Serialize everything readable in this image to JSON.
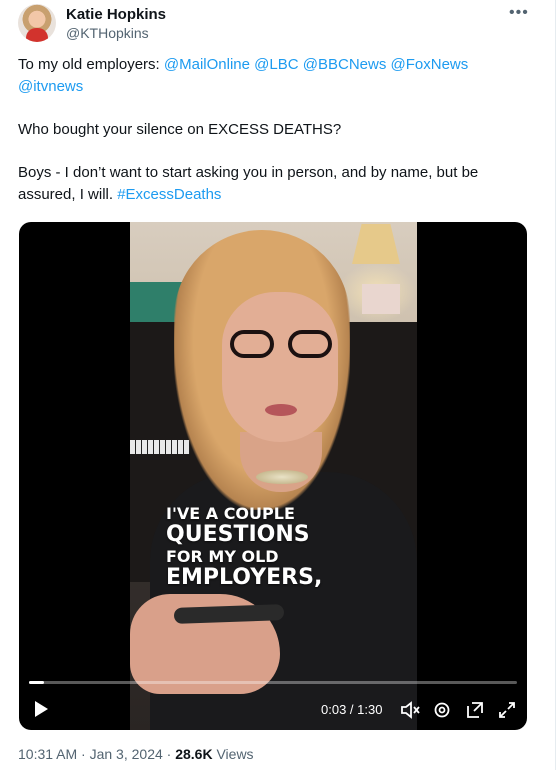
{
  "author": {
    "name": "Katie Hopkins",
    "handle": "@KTHopkins"
  },
  "more_icon": "more-horizontal-icon",
  "tweet": {
    "line1_prefix": "To my old employers: ",
    "mentions": [
      "@MailOnline",
      "@LBC",
      "@BBCNews",
      "@FoxNews",
      "@itvnews"
    ],
    "line2": "Who bought your silence on EXCESS DEATHS?",
    "line3a": "Boys - I don’t want to start asking you in person, and by name, but be",
    "line3b": "assured, I will. ",
    "hashtag": "#ExcessDeaths"
  },
  "video": {
    "caption": [
      "I'VE A COUPLE",
      "QUESTIONS",
      "FOR MY OLD",
      "EMPLOYERS,"
    ],
    "time": "0:03 / 1:30",
    "progress": 0.03,
    "icons": [
      "play-icon",
      "mute-icon",
      "settings-icon",
      "picture-in-picture-icon",
      "fullscreen-icon"
    ]
  },
  "footer": {
    "time": "10:31 AM · Jan 3, 2024 · ",
    "views_count": "28.6K",
    "views_label": " Views"
  }
}
